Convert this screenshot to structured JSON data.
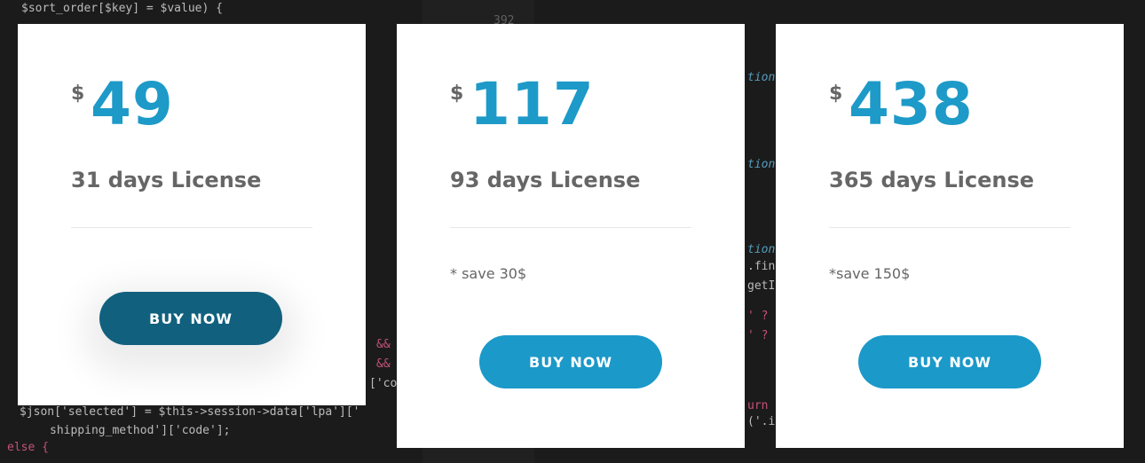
{
  "plans": [
    {
      "currency": "$",
      "amount": "49",
      "license": "31 days License",
      "note": "",
      "button": "BUY NOW"
    },
    {
      "currency": "$",
      "amount": "117",
      "license": "93 days License",
      "note": "* save 30$",
      "button": "BUY NOW"
    },
    {
      "currency": "$",
      "amount": "438",
      "license": "365 days License",
      "note": "*save 150$",
      "button": "BUY NOW"
    }
  ],
  "background_code": {
    "line_1": "$sort_order[$key] = $value) {",
    "line_2": "$json['selected'] = $this->session->data['lpa']['",
    "line_3": "shipping_method']['code'];",
    "line_4": "else {",
    "line_5": "392",
    "line_6": "tion",
    "line_7": "tion",
    "line_8": "tion",
    "line_9": ".fin",
    "line_10": "getI",
    "line_11": "' ?",
    "line_12": "' ?",
    "line_13": "urn",
    "line_14": "('.it",
    "line_15": "&&",
    "line_16": "&&",
    "line_17": "['cod"
  },
  "colors": {
    "accent": "#1d9ac8",
    "button": "#1b99c9",
    "button_active": "#11607e",
    "text_muted": "#666666"
  }
}
